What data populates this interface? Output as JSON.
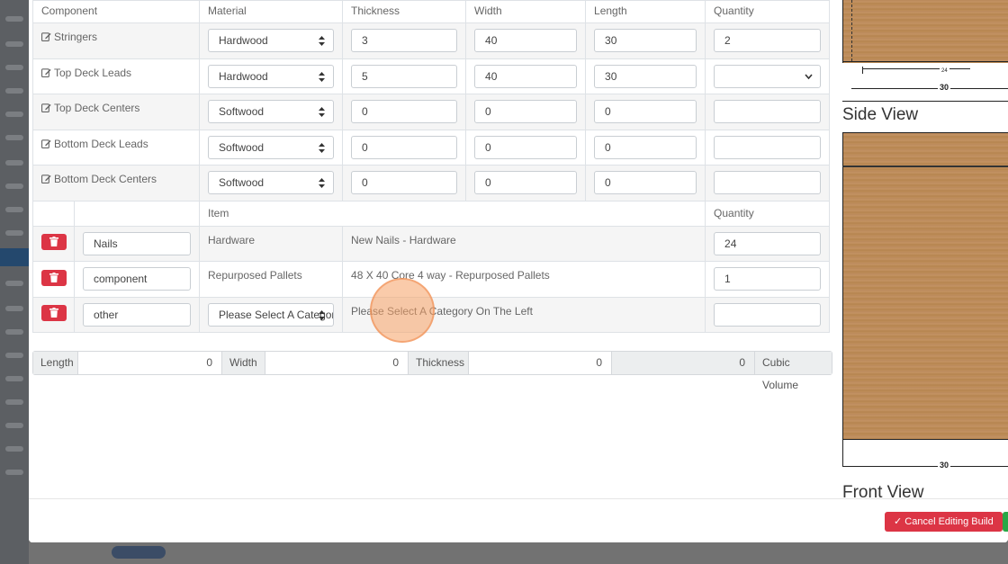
{
  "headers": {
    "component": "Component",
    "material": "Material",
    "thickness": "Thickness",
    "width": "Width",
    "length": "Length",
    "quantity": "Quantity"
  },
  "components": [
    {
      "name": "Stringers",
      "material": "Hardwood",
      "thickness": "3",
      "width": "40",
      "length": "30",
      "quantity": "2"
    },
    {
      "name": "Top Deck Leads",
      "material": "Hardwood",
      "thickness": "5",
      "width": "40",
      "length": "30",
      "quantity": ""
    },
    {
      "name": "Top Deck Centers",
      "material": "Softwood",
      "thickness": "0",
      "width": "0",
      "length": "0",
      "quantity": ""
    },
    {
      "name": "Bottom Deck Leads",
      "material": "Softwood",
      "thickness": "0",
      "width": "0",
      "length": "0",
      "quantity": ""
    },
    {
      "name": "Bottom Deck Centers",
      "material": "Softwood",
      "thickness": "0",
      "width": "0",
      "length": "0",
      "quantity": ""
    }
  ],
  "items_header": {
    "item": "Item",
    "quantity": "Quantity"
  },
  "items": [
    {
      "name": "Nails",
      "category": "Hardware",
      "description": "New Nails - Hardware",
      "quantity": "24"
    },
    {
      "name": "component",
      "category": "Repurposed Pallets",
      "description": "48 X 40 Core 4 way - Repurposed Pallets",
      "quantity": "1"
    },
    {
      "name": "other",
      "category_select": "Please Select A Category",
      "description": "Please Select A Category On The Left",
      "quantity": ""
    }
  ],
  "volume": {
    "length_label": "Length",
    "length_value": "0",
    "width_label": "Width",
    "width_value": "0",
    "thickness_label": "Thickness",
    "thickness_value": "0",
    "cubic_value": "0",
    "cubic_label": "Cubic Volume"
  },
  "drawing": {
    "dim_small": "24",
    "dim_top": "30",
    "side_view": "Side View",
    "dim_bottom": "30",
    "front_view": "Front View"
  },
  "footer": {
    "cancel_label": "✓ Cancel Editing Build"
  },
  "colors": {
    "danger": "#dc3545",
    "success": "#28a745",
    "wood": "#bf8e5d"
  }
}
